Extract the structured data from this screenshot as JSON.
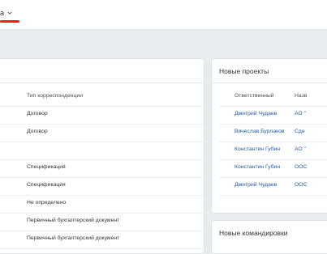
{
  "topbar": {
    "menu_label": "а"
  },
  "colors": {
    "accent_underline": "#e2231a",
    "link": "#1f5aa6"
  },
  "left_panel": {
    "rows": [
      "Тип корреспонденции",
      "Договор",
      "Договор",
      "",
      "Спецификация",
      "Спецификация",
      "Не определено",
      "Первичный бухгалтерский документ",
      "Первичный бухгалтерский документ"
    ]
  },
  "new_projects": {
    "title": "Новые проекты",
    "col_responsible": "Ответственный",
    "col_name": "Назв",
    "rows": [
      {
        "responsible": "Дмитрий Чудаев",
        "name": "АО \""
      },
      {
        "responsible": "Вячеслав Бурлаков",
        "name": "Сде"
      },
      {
        "responsible": "Константин Губин",
        "name": "АО \""
      },
      {
        "responsible": "Константин Губин",
        "name": "ООС"
      },
      {
        "responsible": "Дмитрий Чудаев",
        "name": "ООС"
      }
    ]
  },
  "new_trips": {
    "title": "Новые командировки"
  }
}
